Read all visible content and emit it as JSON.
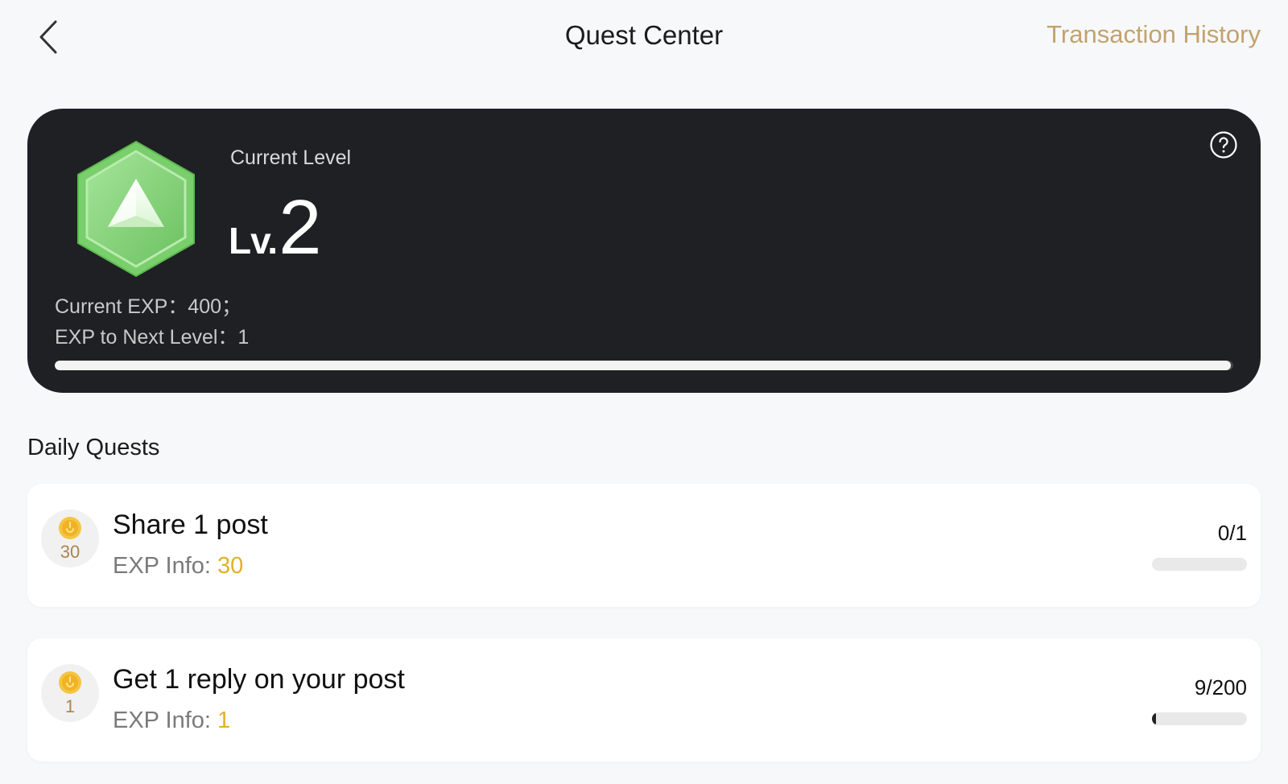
{
  "header": {
    "title": "Quest Center",
    "transaction_link": "Transaction History",
    "back_icon": "chevron-left-icon"
  },
  "level_card": {
    "label": "Current Level",
    "level_prefix": "Lv.",
    "level_number": "2",
    "current_exp_text": "Current EXP：400；",
    "next_level_text": "EXP to Next Level：1",
    "progress_fraction": 0.998,
    "help_icon": "question-circle-icon",
    "badge_icon": "green-hexagon-triangle-badge"
  },
  "daily_quests": {
    "title": "Daily Quests",
    "items": [
      {
        "coin_amount": "30",
        "title": "Share 1 post",
        "exp_label": "EXP Info: ",
        "exp_value": "30",
        "progress_text": "0/1",
        "progress_fraction": 0.0
      },
      {
        "coin_amount": "1",
        "title": "Get 1 reply on your post",
        "exp_label": "EXP Info: ",
        "exp_value": "1",
        "progress_text": "9/200",
        "progress_fraction": 0.045
      }
    ]
  },
  "colors": {
    "accent_gold": "#c1a36e",
    "card_dark": "#1f2023",
    "exp_value": "#e0b12a",
    "badge_green": "#7fd070"
  }
}
